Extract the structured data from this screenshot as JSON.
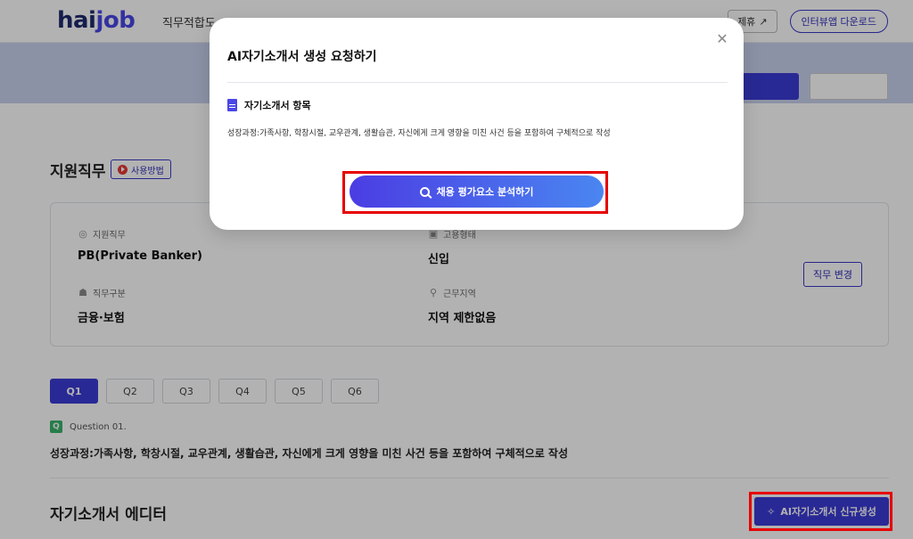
{
  "header": {
    "logo": {
      "part1": "hai",
      "part2": "job"
    },
    "nav": [
      "직무적합도"
    ],
    "partner_label": "제휴",
    "app_download_label": "인터뷰앱 다운로드"
  },
  "page": {
    "apply_section_title": "지원직무",
    "howto_label": "사용방법",
    "fields": {
      "job": {
        "label": "지원직무",
        "value": "PB(Private Banker)"
      },
      "employment": {
        "label": "고용형태",
        "value": "신입"
      },
      "category": {
        "label": "직무구분",
        "value": "금융·보험"
      },
      "location": {
        "label": "근무지역",
        "value": "지역 제한없음"
      }
    },
    "change_job_label": "직무 변경",
    "question_tabs": [
      "Q1",
      "Q2",
      "Q3",
      "Q4",
      "Q5",
      "Q6"
    ],
    "question_badge": "Q",
    "question_label": "Question 01.",
    "question_text": "성장과정:가족사항, 학창시절, 교우관계, 생활습관, 자신에게 크게 영향을 미친 사건 등을 포함하여 구체적으로 작성",
    "editor_title": "자기소개서 에디터",
    "new_ai_label": "AI자기소개서 신규생성"
  },
  "modal": {
    "title": "AI자기소개서 생성 요청하기",
    "section_label": "자기소개서 항목",
    "description": "성장과정:가족사항, 학창시절, 교우관계, 생활습관, 자신에게 크게 영향을 미친 사건 등을 포함하여 구체적으로 작성",
    "analyze_label": "채용 평가요소 분석하기",
    "close_glyph": "✕"
  },
  "colors": {
    "primary": "#3b3bd6",
    "highlight": "#e60000",
    "badge": "#38b36b"
  }
}
